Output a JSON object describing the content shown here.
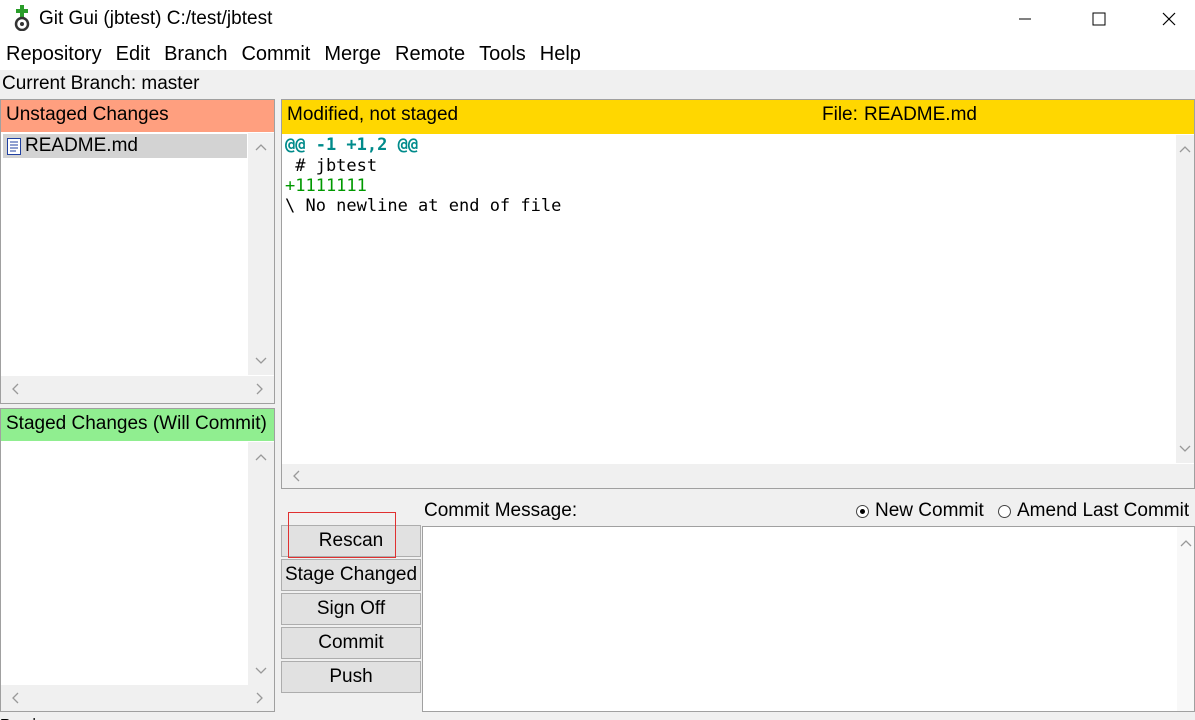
{
  "window": {
    "title": "Git Gui (jbtest) C:/test/jbtest",
    "app_icon": "git-gui-icon",
    "controls": [
      "minimize-icon",
      "maximize-icon",
      "close-icon"
    ]
  },
  "menubar": {
    "items": [
      "Repository",
      "Edit",
      "Branch",
      "Commit",
      "Merge",
      "Remote",
      "Tools",
      "Help"
    ]
  },
  "current_branch": "Current Branch: master",
  "unstaged": {
    "header": "Unstaged Changes",
    "files": [
      "README.md"
    ]
  },
  "staged": {
    "header": "Staged Changes (Will Commit)",
    "files": []
  },
  "diff": {
    "status": "Modified, not staged",
    "file_label": "File:",
    "file_name": "README.md",
    "lines": {
      "hunk": "@@ -1 +1,2 @@",
      "context": " # jbtest",
      "added": "+1111111",
      "no_newline": "\\ No newline at end of file"
    }
  },
  "commit": {
    "message_label": "Commit Message:",
    "new_commit": "New Commit",
    "amend": "Amend Last Commit",
    "selected_mode": "new_commit",
    "message": ""
  },
  "buttons": {
    "rescan": "Rescan",
    "stage_changed": "Stage Changed",
    "sign_off": "Sign Off",
    "commit": "Commit",
    "push": "Push"
  },
  "status_bar": "Ready.",
  "colors": {
    "unstaged_header": "#ff9f7f",
    "staged_header": "#90ee90",
    "diff_header": "#ffd700",
    "hunk": "#008b8b",
    "added": "#009900",
    "highlight": "#e03030"
  }
}
